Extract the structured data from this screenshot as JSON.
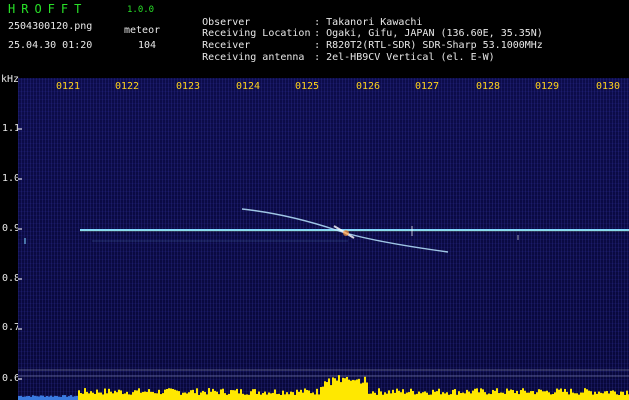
{
  "header": {
    "app_title": "HROFFT",
    "app_version": "1.0.0",
    "file_name": "2504300120.png",
    "mode_label": "meteor",
    "timestamp": "25.04.30 01:20",
    "count_value": "104",
    "info": [
      {
        "key": "Observer",
        "value": "Takanori Kawachi"
      },
      {
        "key": "Receiving Location",
        "value": "Ogaki, Gifu, JAPAN (136.60E, 35.35N)"
      },
      {
        "key": "Receiver",
        "value": "R820T2(RTL-SDR) SDR-Sharp 53.1000MHz"
      },
      {
        "key": "Receiving antenna",
        "value": "2el-HB9CV Vertical (el. E-W)"
      }
    ],
    "separator": ":"
  },
  "plot": {
    "unit_label": "kHz",
    "time_ticks": [
      "0121",
      "0122",
      "0123",
      "0124",
      "0125",
      "0126",
      "0127",
      "0128",
      "0129",
      "0130"
    ],
    "freq_ticks": [
      "1.1",
      "1.0",
      "0.9",
      "0.8",
      "0.7",
      "0.6"
    ],
    "carrier_freq_khz": 0.9,
    "colors": {
      "tick_label": "#ffd21a",
      "carrier": "#7fd6ff",
      "echo": "#b8e6ff",
      "spectrum": "#ffe800",
      "background": "#0a0a40"
    }
  }
}
